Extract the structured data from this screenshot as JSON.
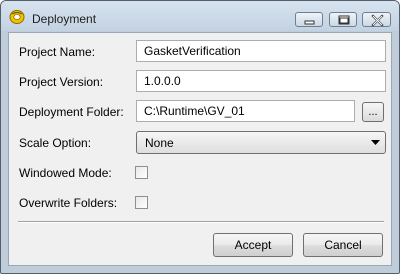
{
  "window": {
    "title": "Deployment",
    "app_icon": "deployment-app-icon",
    "controls": {
      "minimize_icon": "minimize-icon",
      "maximize_icon": "maximize-icon",
      "close_icon": "close-icon"
    }
  },
  "form": {
    "project_name": {
      "label": "Project Name:",
      "value": "GasketVerification"
    },
    "project_version": {
      "label": "Project Version:",
      "value": "1.0.0.0"
    },
    "deployment_folder": {
      "label": "Deployment Folder:",
      "value": "C:\\Runtime\\GV_01",
      "browse_label": "..."
    },
    "scale_option": {
      "label": "Scale Option:",
      "value": "None"
    },
    "windowed_mode": {
      "label": "Windowed Mode:",
      "checked": false
    },
    "overwrite_folders": {
      "label": "Overwrite Folders:",
      "checked": false
    }
  },
  "buttons": {
    "accept_label": "Accept",
    "cancel_label": "Cancel"
  },
  "colors": {
    "title_bar": "#c9d7e6",
    "dialog_background": "#f0f0f0",
    "close_hover_accent": "#c75050"
  }
}
